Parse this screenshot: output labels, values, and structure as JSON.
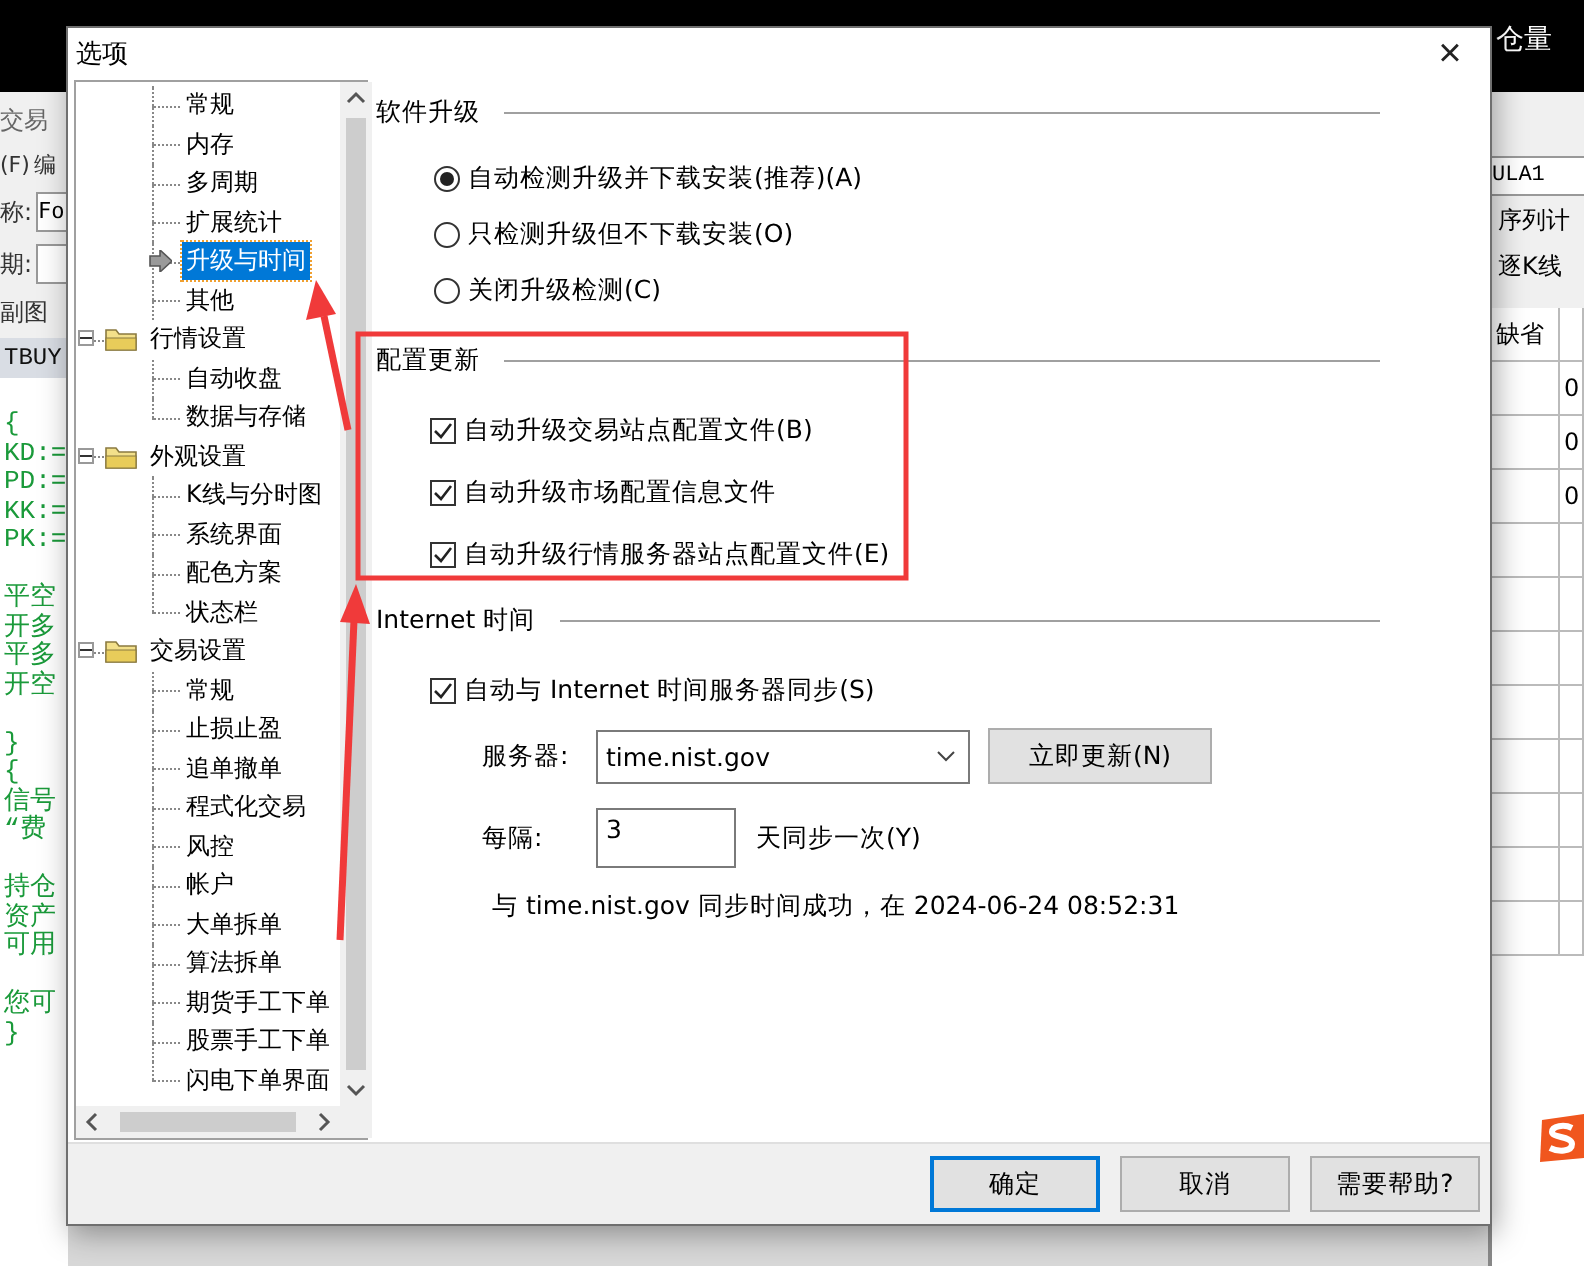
{
  "background": {
    "top_right_label": "仓量",
    "left_strip": {
      "title": "交易",
      "menu": [
        "(F)",
        "编"
      ],
      "fields": [
        {
          "label": "称:",
          "value": "Fo"
        },
        {
          "label": "期:"
        }
      ],
      "tab": "副图",
      "header": "TBUY",
      "code_blocks": [
        [
          "{",
          "KD:=",
          "PD:=",
          "KK:=",
          "PK:="
        ],
        [
          "平空",
          "开多",
          "平多",
          "开空"
        ],
        [
          "}",
          "{",
          "信号",
          "“费"
        ],
        [
          "持仓",
          "资产",
          "可用"
        ],
        [
          "您可",
          "}"
        ]
      ]
    },
    "right_strip": {
      "formula_field": "ULA1",
      "options": [
        "序列计",
        "逐K线"
      ],
      "table_header": "缺省",
      "cells": [
        "0",
        "0",
        "0"
      ]
    }
  },
  "dialog": {
    "title": "选项",
    "close": "×",
    "tree": {
      "items": [
        {
          "label": "常规",
          "selected": false
        },
        {
          "label": "内存",
          "selected": false
        },
        {
          "label": "多周期",
          "selected": false
        },
        {
          "label": "扩展统计",
          "selected": false
        },
        {
          "label": "升级与时间",
          "selected": true
        },
        {
          "label": "其他",
          "selected": false
        },
        {
          "label": "行情设置",
          "expanded": true,
          "children": [
            {
              "label": "自动收盘",
              "selected": false
            },
            {
              "label": "数据与存储",
              "selected": false
            }
          ]
        },
        {
          "label": "外观设置",
          "expanded": true,
          "children": [
            {
              "label": "K线与分时图",
              "selected": false
            },
            {
              "label": "系统界面",
              "selected": false
            },
            {
              "label": "配色方案",
              "selected": false
            },
            {
              "label": "状态栏",
              "selected": false
            }
          ]
        },
        {
          "label": "交易设置",
          "expanded": true,
          "children": [
            {
              "label": "常规",
              "selected": false
            },
            {
              "label": "止损止盈",
              "selected": false
            },
            {
              "label": "追单撤单",
              "selected": false
            },
            {
              "label": "程式化交易",
              "selected": false
            },
            {
              "label": "风控",
              "selected": false
            },
            {
              "label": "帐户",
              "selected": false
            },
            {
              "label": "大单拆单",
              "selected": false
            },
            {
              "label": "算法拆单",
              "selected": false
            },
            {
              "label": "期货手工下单",
              "selected": false
            },
            {
              "label": "股票手工下单",
              "selected": false
            },
            {
              "label": "闪电下单界面",
              "selected": false
            }
          ]
        }
      ]
    },
    "upgrade": {
      "title": "软件升级",
      "options": [
        {
          "label": "自动检测升级并下载安装(推荐)(A)",
          "selected": true
        },
        {
          "label": "只检测升级但不下载安装(O)",
          "selected": false
        },
        {
          "label": "关闭升级检测(C)",
          "selected": false
        }
      ]
    },
    "config_update": {
      "title": "配置更新",
      "options": [
        {
          "label": "自动升级交易站点配置文件(B)",
          "checked": true
        },
        {
          "label": "自动升级市场配置信息文件",
          "checked": true
        },
        {
          "label": "自动升级行情服务器站点配置文件(E)",
          "checked": true
        }
      ]
    },
    "internet_time": {
      "title": "Internet 时间",
      "sync": {
        "label": "自动与 Internet 时间服务器同步(S)",
        "checked": true
      },
      "server_label": "服务器:",
      "server": "time.nist.gov",
      "update_button": "立即更新(N)",
      "interval_label": "每隔:",
      "interval": "3",
      "interval_unit": "天同步一次(Y)",
      "status": "与 time.nist.gov 同步时间成功，在 2024-06-24 08:52:31"
    },
    "buttons": [
      {
        "label": "确定",
        "default": true
      },
      {
        "label": "取消",
        "default": false
      },
      {
        "label": "需要帮助?",
        "default": false
      }
    ]
  }
}
